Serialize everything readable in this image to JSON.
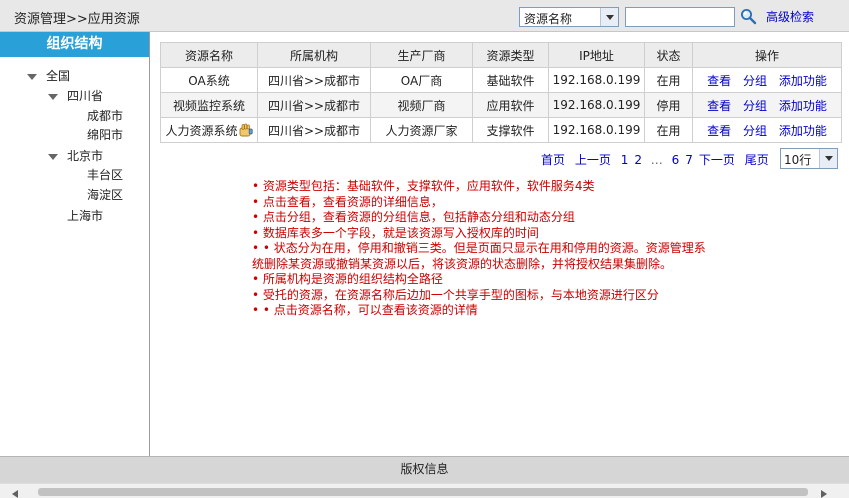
{
  "header": {
    "breadcrumb": "资源管理>>应用资源",
    "search_select_value": "资源名称",
    "search_input_value": "",
    "search_icon": "search-icon",
    "advanced_search_label": "高级检索"
  },
  "sidebar": {
    "title": "组织结构",
    "tree": [
      {
        "label": "全国",
        "level": 0,
        "expanded": true
      },
      {
        "label": "四川省",
        "level": 1,
        "expanded": true
      },
      {
        "label": "成都市",
        "level": 2
      },
      {
        "label": "绵阳市",
        "level": 2
      },
      {
        "label": "北京市",
        "level": 1,
        "expanded": true
      },
      {
        "label": "丰台区",
        "level": 2
      },
      {
        "label": "海淀区",
        "level": 2
      },
      {
        "label": "上海市",
        "level": 1
      }
    ]
  },
  "table": {
    "columns": [
      "资源名称",
      "所属机构",
      "生产厂商",
      "资源类型",
      "IP地址",
      "状态",
      "操作"
    ],
    "rows": [
      {
        "name": "OA系统",
        "org": "四川省>>成都市",
        "vendor": "OA厂商",
        "type": "基础软件",
        "ip": "192.168.0.199",
        "status": "在用",
        "shared": false
      },
      {
        "name": "视频监控系统",
        "org": "四川省>>成都市",
        "vendor": "视频厂商",
        "type": "应用软件",
        "ip": "192.168.0.199",
        "status": "停用",
        "shared": false
      },
      {
        "name": "人力资源系统",
        "org": "四川省>>成都市",
        "vendor": "人力资源厂家",
        "type": "支撑软件",
        "ip": "192.168.0.199",
        "status": "在用",
        "shared": true
      }
    ],
    "actions": [
      "查看",
      "分组",
      "添加功能"
    ]
  },
  "pagination": {
    "first": "首页",
    "prev": "上一页",
    "pages_before": [
      "1",
      "2"
    ],
    "ellipsis": "…",
    "pages_after": [
      "6",
      "7"
    ],
    "next": "下一页",
    "last": "尾页",
    "page_size": "10行"
  },
  "notes": [
    "• 资源类型包括：基础软件，支撑软件，应用软件，软件服务4类",
    "• 点击查看，查看资源的详细信息，",
    "• 点击分组，查看资源的分组信息，包括静态分组和动态分组",
    "• 数据库表多一个字段，就是该资源写入授权库的时间",
    "• • 状态分为在用，停用和撤销三类。但是页面只显示在用和停用的资源。资源管理系",
    "统删除某资源或撤销某资源以后，将该资源的状态删除，并将授权结果集删除。",
    "• 所属机构是资源的组织结构全路径",
    "• 受托的资源，在资源名称后边加一个共享手型的图标，与本地资源进行区分",
    "• • 点击资源名称，可以查看该资源的详情"
  ],
  "footer": {
    "copyright": "版权信息"
  },
  "colors": {
    "sidebar_header_bg": "#2aa0d8",
    "link": "#0000cc",
    "note": "#cc0000"
  }
}
